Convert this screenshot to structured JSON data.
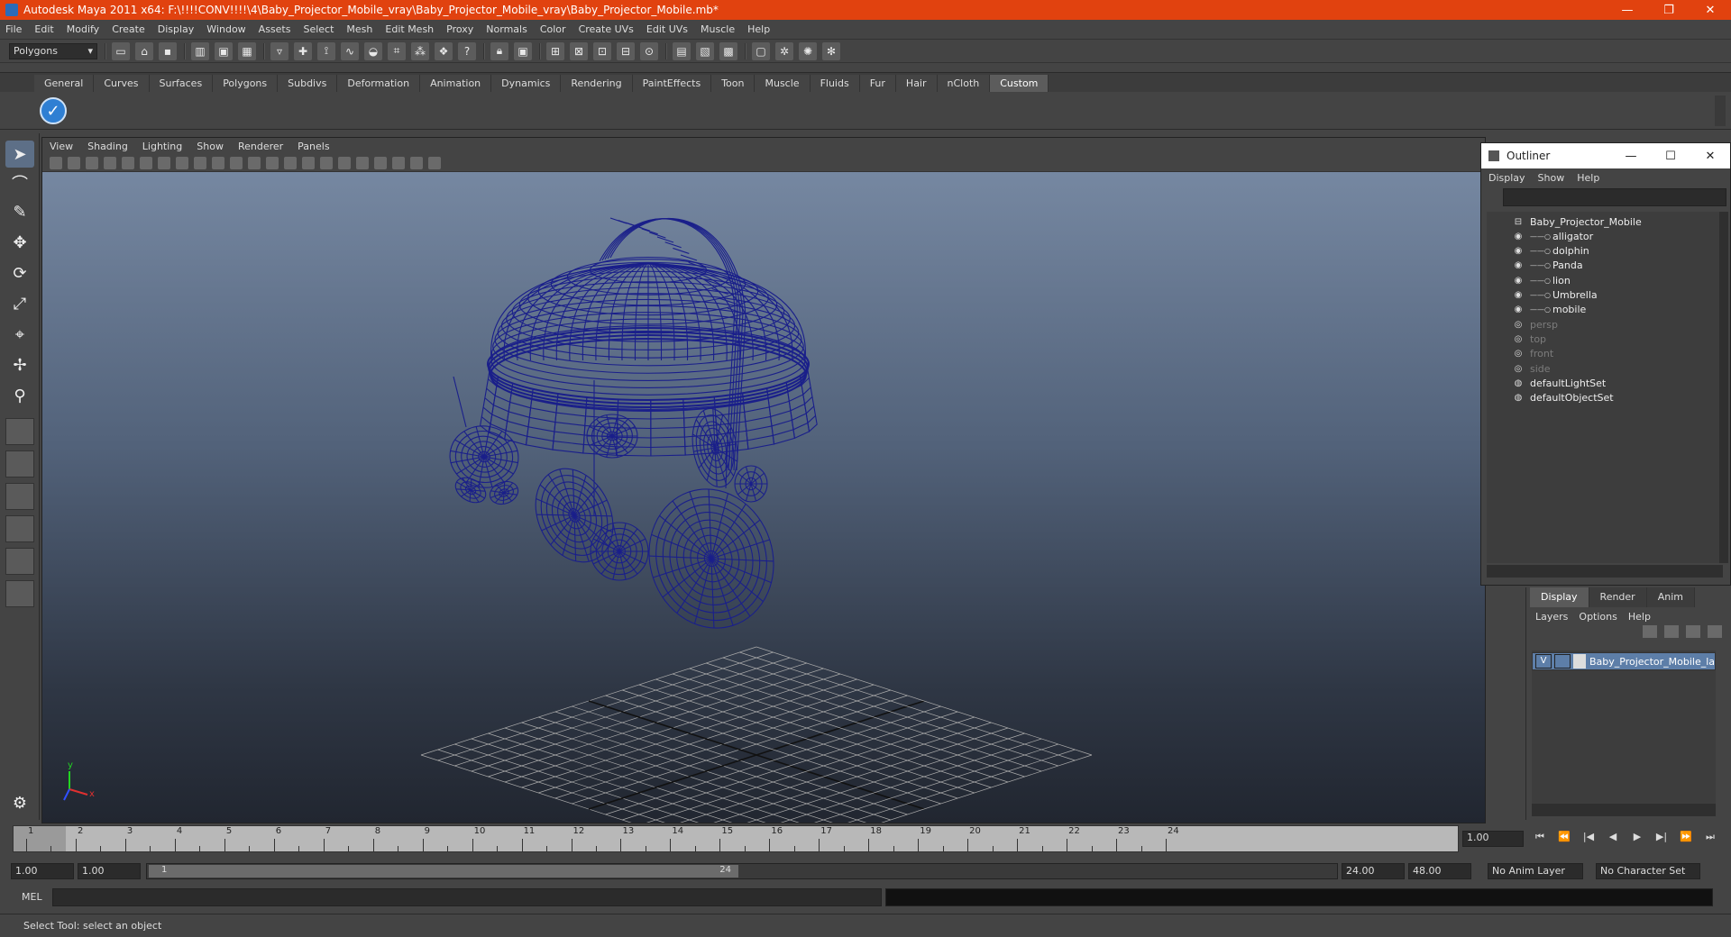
{
  "window": {
    "title": "Autodesk Maya 2011 x64: F:\\!!!!CONV!!!!\\4\\Baby_Projector_Mobile_vray\\Baby_Projector_Mobile_vray\\Baby_Projector_Mobile.mb*",
    "controls": [
      "—",
      "❐",
      "✕"
    ]
  },
  "menubar": [
    "File",
    "Edit",
    "Modify",
    "Create",
    "Display",
    "Window",
    "Assets",
    "Select",
    "Mesh",
    "Edit Mesh",
    "Proxy",
    "Normals",
    "Color",
    "Create UVs",
    "Edit UVs",
    "Muscle",
    "Help"
  ],
  "status": {
    "mode": "Polygons"
  },
  "shelf": {
    "tabs": [
      "General",
      "Curves",
      "Surfaces",
      "Polygons",
      "Subdivs",
      "Deformation",
      "Animation",
      "Dynamics",
      "Rendering",
      "PaintEffects",
      "Toon",
      "Muscle",
      "Fluids",
      "Fur",
      "Hair",
      "nCloth",
      "Custom"
    ],
    "active_tab": "Custom"
  },
  "viewport": {
    "menu": [
      "View",
      "Shading",
      "Lighting",
      "Show",
      "Renderer",
      "Panels"
    ],
    "wire_color": "#1a1f8a",
    "axis_x": "x",
    "axis_y": "y"
  },
  "outliner": {
    "title": "Outliner",
    "menu": [
      "Display",
      "Show",
      "Help"
    ],
    "items": [
      {
        "label": "Baby_Projector_Mobile",
        "indent": 0,
        "dim": false,
        "icon": "⊟"
      },
      {
        "label": "alligator",
        "indent": 1,
        "dim": false,
        "icon": "◉"
      },
      {
        "label": "dolphin",
        "indent": 1,
        "dim": false,
        "icon": "◉"
      },
      {
        "label": "Panda",
        "indent": 1,
        "dim": false,
        "icon": "◉"
      },
      {
        "label": "lion",
        "indent": 1,
        "dim": false,
        "icon": "◉"
      },
      {
        "label": "Umbrella",
        "indent": 1,
        "dim": false,
        "icon": "◉"
      },
      {
        "label": "mobile",
        "indent": 1,
        "dim": false,
        "icon": "◉"
      },
      {
        "label": "persp",
        "indent": 0,
        "dim": true,
        "icon": "◎"
      },
      {
        "label": "top",
        "indent": 0,
        "dim": true,
        "icon": "◎"
      },
      {
        "label": "front",
        "indent": 0,
        "dim": true,
        "icon": "◎"
      },
      {
        "label": "side",
        "indent": 0,
        "dim": true,
        "icon": "◎"
      },
      {
        "label": "defaultLightSet",
        "indent": 0,
        "dim": false,
        "icon": "◍"
      },
      {
        "label": "defaultObjectSet",
        "indent": 0,
        "dim": false,
        "icon": "◍"
      }
    ]
  },
  "layers": {
    "tabs": [
      "Display",
      "Render",
      "Anim"
    ],
    "active_tab": "Display",
    "menu": [
      "Layers",
      "Options",
      "Help"
    ],
    "row": {
      "visible": "V",
      "name": "Baby_Projector_Mobile_la"
    }
  },
  "timeline": {
    "start": 1,
    "end": 24,
    "current": 1,
    "current_field": "1.00",
    "labels": [
      "1",
      "2",
      "3",
      "4",
      "5",
      "6",
      "7",
      "8",
      "9",
      "10",
      "11",
      "12",
      "13",
      "14",
      "15",
      "16",
      "17",
      "18",
      "19",
      "20",
      "21",
      "22",
      "23",
      "24"
    ],
    "playback": [
      "⏮",
      "⏪",
      "|◀",
      "◀",
      "▶",
      "▶|",
      "⏩",
      "⏭"
    ]
  },
  "range": {
    "start": "1.00",
    "anim_start": "1.00",
    "bar_start": "1",
    "bar_end": "24",
    "end": "24.00",
    "anim_end": "48.00",
    "anim_layer": "No Anim Layer",
    "char_set": "No Character Set"
  },
  "cmd": {
    "lang": "MEL"
  },
  "help": {
    "text": "Select Tool: select an object"
  }
}
